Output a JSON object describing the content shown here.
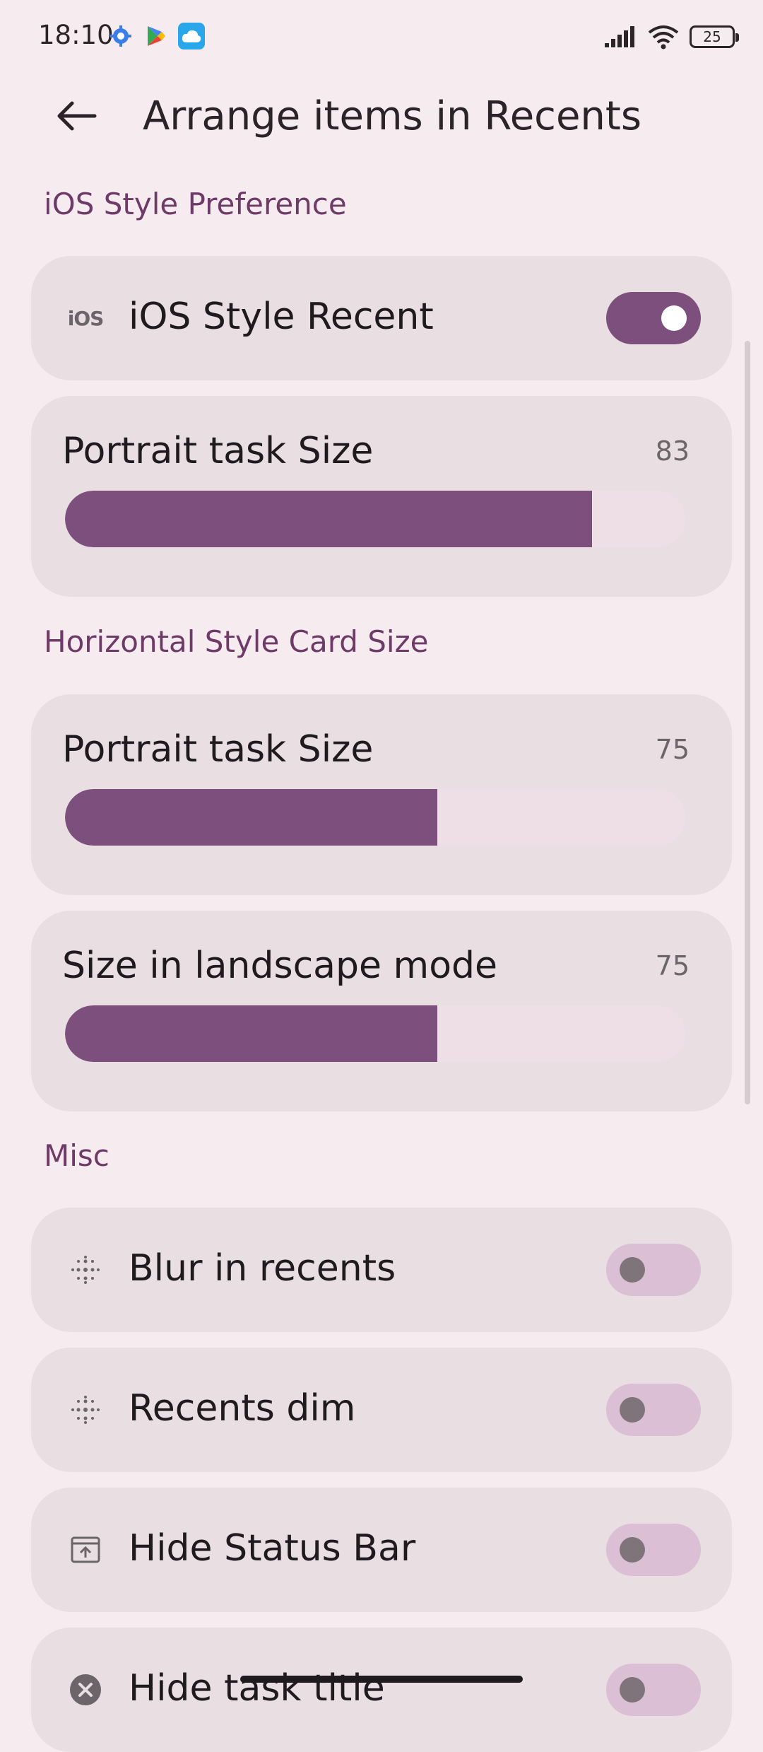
{
  "status_bar": {
    "time": "18:10",
    "battery": "25",
    "icons": [
      "gear-icon",
      "play-store-icon",
      "cloud-icon",
      "signal-icon",
      "wifi-icon",
      "battery-icon"
    ]
  },
  "header": {
    "title": "Arrange items in Recents",
    "back_icon": "arrow-left-icon"
  },
  "sections": {
    "ios_style": {
      "label": "iOS Style Preference",
      "ios_recent": {
        "icon_text": "iOS",
        "label": "iOS Style Recent",
        "enabled": true
      },
      "portrait_task": {
        "label": "Portrait task Size",
        "value": "83",
        "fraction": 0.85
      }
    },
    "horizontal": {
      "label": "Horizontal Style Card Size",
      "portrait_task": {
        "label": "Portrait task Size",
        "value": "75",
        "fraction": 0.6
      },
      "landscape": {
        "label": "Size in landscape mode",
        "value": "75",
        "fraction": 0.6
      }
    },
    "misc": {
      "label": "Misc",
      "blur": {
        "label": "Blur in recents",
        "enabled": false
      },
      "dim": {
        "label": "Recents dim",
        "enabled": false
      },
      "hide_status": {
        "label": "Hide Status Bar",
        "enabled": false
      },
      "hide_title": {
        "label": "Hide task title",
        "enabled": false
      }
    }
  },
  "colors": {
    "accent": "#7d4f7c",
    "section_label": "#6e3a67",
    "card_bg": "#e9dee2",
    "page_bg": "#f6ecf0"
  }
}
